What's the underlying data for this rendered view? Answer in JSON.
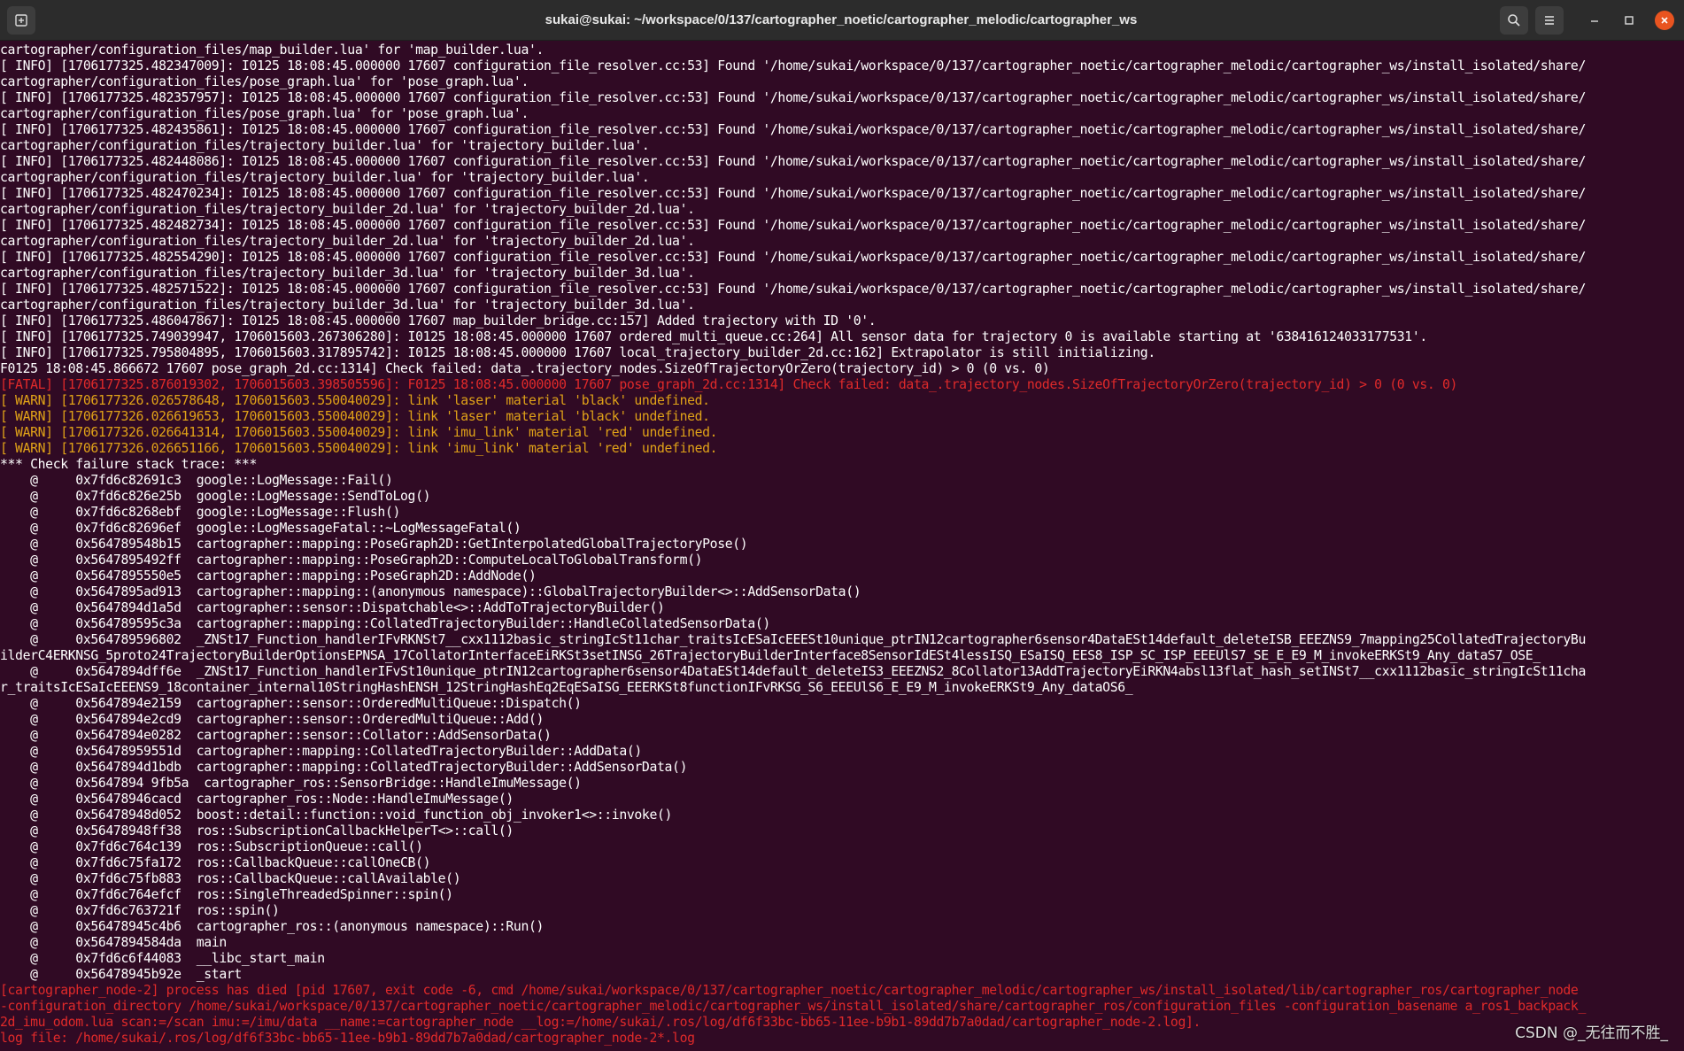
{
  "window": {
    "title": "sukai@sukai: ~/workspace/0/137/cartographer_noetic/cartographer_melodic/cartographer_ws"
  },
  "colors": {
    "background": "#300a24",
    "text": "#ffffff",
    "fatal": "#e02a2a",
    "warn": "#e0a218",
    "titlebar": "#2c2c2c",
    "close_button": "#e95420"
  },
  "icons": {
    "new_tab": "new-tab-icon",
    "search": "search-icon",
    "menu": "hamburger-menu-icon",
    "minimize": "minimize-icon",
    "maximize": "maximize-icon",
    "close": "close-icon"
  },
  "terminal": {
    "lines": [
      {
        "text": "cartographer/configuration_files/map_builder.lua' for 'map_builder.lua'.",
        "level": "info"
      },
      {
        "text": "[ INFO] [1706177325.482347009]: I0125 18:08:45.000000 17607 configuration_file_resolver.cc:53] Found '/home/sukai/workspace/0/137/cartographer_noetic/cartographer_melodic/cartographer_ws/install_isolated/share/",
        "level": "info"
      },
      {
        "text": "cartographer/configuration_files/pose_graph.lua' for 'pose_graph.lua'.",
        "level": "info"
      },
      {
        "text": "[ INFO] [1706177325.482357957]: I0125 18:08:45.000000 17607 configuration_file_resolver.cc:53] Found '/home/sukai/workspace/0/137/cartographer_noetic/cartographer_melodic/cartographer_ws/install_isolated/share/",
        "level": "info"
      },
      {
        "text": "cartographer/configuration_files/pose_graph.lua' for 'pose_graph.lua'.",
        "level": "info"
      },
      {
        "text": "[ INFO] [1706177325.482435861]: I0125 18:08:45.000000 17607 configuration_file_resolver.cc:53] Found '/home/sukai/workspace/0/137/cartographer_noetic/cartographer_melodic/cartographer_ws/install_isolated/share/",
        "level": "info"
      },
      {
        "text": "cartographer/configuration_files/trajectory_builder.lua' for 'trajectory_builder.lua'.",
        "level": "info"
      },
      {
        "text": "[ INFO] [1706177325.482448086]: I0125 18:08:45.000000 17607 configuration_file_resolver.cc:53] Found '/home/sukai/workspace/0/137/cartographer_noetic/cartographer_melodic/cartographer_ws/install_isolated/share/",
        "level": "info"
      },
      {
        "text": "cartographer/configuration_files/trajectory_builder.lua' for 'trajectory_builder.lua'.",
        "level": "info"
      },
      {
        "text": "[ INFO] [1706177325.482470234]: I0125 18:08:45.000000 17607 configuration_file_resolver.cc:53] Found '/home/sukai/workspace/0/137/cartographer_noetic/cartographer_melodic/cartographer_ws/install_isolated/share/",
        "level": "info"
      },
      {
        "text": "cartographer/configuration_files/trajectory_builder_2d.lua' for 'trajectory_builder_2d.lua'.",
        "level": "info"
      },
      {
        "text": "[ INFO] [1706177325.482482734]: I0125 18:08:45.000000 17607 configuration_file_resolver.cc:53] Found '/home/sukai/workspace/0/137/cartographer_noetic/cartographer_melodic/cartographer_ws/install_isolated/share/",
        "level": "info"
      },
      {
        "text": "cartographer/configuration_files/trajectory_builder_2d.lua' for 'trajectory_builder_2d.lua'.",
        "level": "info"
      },
      {
        "text": "[ INFO] [1706177325.482554290]: I0125 18:08:45.000000 17607 configuration_file_resolver.cc:53] Found '/home/sukai/workspace/0/137/cartographer_noetic/cartographer_melodic/cartographer_ws/install_isolated/share/",
        "level": "info"
      },
      {
        "text": "cartographer/configuration_files/trajectory_builder_3d.lua' for 'trajectory_builder_3d.lua'.",
        "level": "info"
      },
      {
        "text": "[ INFO] [1706177325.482571522]: I0125 18:08:45.000000 17607 configuration_file_resolver.cc:53] Found '/home/sukai/workspace/0/137/cartographer_noetic/cartographer_melodic/cartographer_ws/install_isolated/share/",
        "level": "info"
      },
      {
        "text": "cartographer/configuration_files/trajectory_builder_3d.lua' for 'trajectory_builder_3d.lua'.",
        "level": "info"
      },
      {
        "text": "[ INFO] [1706177325.486047867]: I0125 18:08:45.000000 17607 map_builder_bridge.cc:157] Added trajectory with ID '0'.",
        "level": "info"
      },
      {
        "text": "[ INFO] [1706177325.749039947, 1706015603.267306280]: I0125 18:08:45.000000 17607 ordered_multi_queue.cc:264] All sensor data for trajectory 0 is available starting at '638416124033177531'.",
        "level": "info"
      },
      {
        "text": "[ INFO] [1706177325.795804895, 1706015603.317895742]: I0125 18:08:45.000000 17607 local_trajectory_builder_2d.cc:162] Extrapolator is still initializing.",
        "level": "info"
      },
      {
        "text": "F0125 18:08:45.866672 17607 pose_graph_2d.cc:1314] Check failed: data_.trajectory_nodes.SizeOfTrajectoryOrZero(trajectory_id) > 0 (0 vs. 0)",
        "level": "info"
      },
      {
        "text": "[FATAL] [1706177325.876019302, 1706015603.398505596]: F0125 18:08:45.000000 17607 pose_graph_2d.cc:1314] Check failed: data_.trajectory_nodes.SizeOfTrajectoryOrZero(trajectory_id) > 0 (0 vs. 0)",
        "level": "fatal"
      },
      {
        "text": "[ WARN] [1706177326.026578648, 1706015603.550040029]: link 'laser' material 'black' undefined.",
        "level": "warn"
      },
      {
        "text": "[ WARN] [1706177326.026619653, 1706015603.550040029]: link 'laser' material 'black' undefined.",
        "level": "warn"
      },
      {
        "text": "[ WARN] [1706177326.026641314, 1706015603.550040029]: link 'imu_link' material 'red' undefined.",
        "level": "warn"
      },
      {
        "text": "[ WARN] [1706177326.026651166, 1706015603.550040029]: link 'imu_link' material 'red' undefined.",
        "level": "warn"
      },
      {
        "text": "*** Check failure stack trace: ***",
        "level": "info"
      },
      {
        "text": "    @     0x7fd6c82691c3  google::LogMessage::Fail()",
        "level": "info"
      },
      {
        "text": "    @     0x7fd6c826e25b  google::LogMessage::SendToLog()",
        "level": "info"
      },
      {
        "text": "    @     0x7fd6c8268ebf  google::LogMessage::Flush()",
        "level": "info"
      },
      {
        "text": "    @     0x7fd6c82696ef  google::LogMessageFatal::~LogMessageFatal()",
        "level": "info"
      },
      {
        "text": "    @     0x564789548b15  cartographer::mapping::PoseGraph2D::GetInterpolatedGlobalTrajectoryPose()",
        "level": "info"
      },
      {
        "text": "    @     0x5647895492ff  cartographer::mapping::PoseGraph2D::ComputeLocalToGlobalTransform()",
        "level": "info"
      },
      {
        "text": "    @     0x5647895550e5  cartographer::mapping::PoseGraph2D::AddNode()",
        "level": "info"
      },
      {
        "text": "    @     0x5647895ad913  cartographer::mapping::(anonymous namespace)::GlobalTrajectoryBuilder<>::AddSensorData()",
        "level": "info"
      },
      {
        "text": "    @     0x5647894d1a5d  cartographer::sensor::Dispatchable<>::AddToTrajectoryBuilder()",
        "level": "info"
      },
      {
        "text": "    @     0x564789595c3a  cartographer::mapping::CollatedTrajectoryBuilder::HandleCollatedSensorData()",
        "level": "info"
      },
      {
        "text": "    @     0x564789596802  _ZNSt17_Function_handlerIFvRKNSt7__cxx1112basic_stringIcSt11char_traitsIcESaIcEEESt10unique_ptrIN12cartographer6sensor4DataESt14default_deleteISB_EEEZNS9_7mapping25CollatedTrajectoryBu",
        "level": "info"
      },
      {
        "text": "ilderC4ERKNSG_5proto24TrajectoryBuilderOptionsEPNSA_17CollatorInterfaceEiRKSt3setINSG_26TrajectoryBuilderInterface8SensorIdESt4lessISQ_ESaISQ_EES8_ISP_SC_ISP_EEEUlS7_SE_E_E9_M_invokeERKSt9_Any_dataS7_OSE_",
        "level": "info"
      },
      {
        "text": "    @     0x5647894dff6e  _ZNSt17_Function_handlerIFvSt10unique_ptrIN12cartographer6sensor4DataESt14default_deleteIS3_EEEZNS2_8Collator13AddTrajectoryEiRKN4absl13flat_hash_setINSt7__cxx1112basic_stringIcSt11cha",
        "level": "info"
      },
      {
        "text": "r_traitsIcESaIcEEENS9_18container_internal10StringHashENSH_12StringHashEq2EqESaISG_EEERKSt8functionIFvRKSG_S6_EEEUlS6_E_E9_M_invokeERKSt9_Any_dataOS6_",
        "level": "info"
      },
      {
        "text": "    @     0x5647894e2159  cartographer::sensor::OrderedMultiQueue::Dispatch()",
        "level": "info"
      },
      {
        "text": "    @     0x5647894e2cd9  cartographer::sensor::OrderedMultiQueue::Add()",
        "level": "info"
      },
      {
        "text": "    @     0x5647894e0282  cartographer::sensor::Collator::AddSensorData()",
        "level": "info"
      },
      {
        "text": "    @     0x56478959551d  cartographer::mapping::CollatedTrajectoryBuilder::AddData()",
        "level": "info"
      },
      {
        "text": "    @     0x5647894d1bdb  cartographer::mapping::CollatedTrajectoryBuilder::AddSensorData()",
        "level": "info"
      },
      {
        "text": "    @     0x5647894 9fb5a  cartographer_ros::SensorBridge::HandleImuMessage()",
        "level": "info"
      },
      {
        "text": "    @     0x56478946cacd  cartographer_ros::Node::HandleImuMessage()",
        "level": "info"
      },
      {
        "text": "    @     0x56478948d052  boost::detail::function::void_function_obj_invoker1<>::invoke()",
        "level": "info"
      },
      {
        "text": "    @     0x56478948ff38  ros::SubscriptionCallbackHelperT<>::call()",
        "level": "info"
      },
      {
        "text": "    @     0x7fd6c764c139  ros::SubscriptionQueue::call()",
        "level": "info"
      },
      {
        "text": "    @     0x7fd6c75fa172  ros::CallbackQueue::callOneCB()",
        "level": "info"
      },
      {
        "text": "    @     0x7fd6c75fb883  ros::CallbackQueue::callAvailable()",
        "level": "info"
      },
      {
        "text": "    @     0x7fd6c764efcf  ros::SingleThreadedSpinner::spin()",
        "level": "info"
      },
      {
        "text": "    @     0x7fd6c763721f  ros::spin()",
        "level": "info"
      },
      {
        "text": "    @     0x56478945c4b6  cartographer_ros::(anonymous namespace)::Run()",
        "level": "info"
      },
      {
        "text": "    @     0x5647894584da  main",
        "level": "info"
      },
      {
        "text": "    @     0x7fd6c6f44083  __libc_start_main",
        "level": "info"
      },
      {
        "text": "    @     0x56478945b92e  _start",
        "level": "info"
      },
      {
        "text": "[cartographer_node-2] process has died [pid 17607, exit code -6, cmd /home/sukai/workspace/0/137/cartographer_noetic/cartographer_melodic/cartographer_ws/install_isolated/lib/cartographer_ros/cartographer_node",
        "level": "fatal"
      },
      {
        "text": "-configuration_directory /home/sukai/workspace/0/137/cartographer_noetic/cartographer_melodic/cartographer_ws/install_isolated/share/cartographer_ros/configuration_files -configuration_basename a_ros1_backpack_",
        "level": "fatal"
      },
      {
        "text": "2d_imu_odom.lua scan:=/scan imu:=/imu/data __name:=cartographer_node __log:=/home/sukai/.ros/log/df6f33bc-bb65-11ee-b9b1-89dd7b7a0dad/cartographer_node-2.log].",
        "level": "fatal"
      },
      {
        "text": "log file: /home/sukai/.ros/log/df6f33bc-bb65-11ee-b9b1-89dd7b7a0dad/cartographer_node-2*.log",
        "level": "fatal"
      }
    ]
  },
  "watermark": "CSDN @_无往而不胜_"
}
